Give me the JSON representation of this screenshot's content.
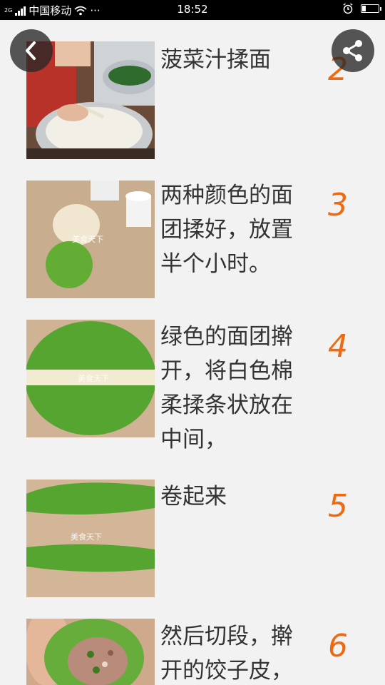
{
  "status_bar": {
    "carrier": "中国移动",
    "network_tag": "2G",
    "more": "···",
    "time": "18:52"
  },
  "nav": {
    "back_icon": "chevron-left-icon",
    "share_icon": "share-icon"
  },
  "steps": [
    {
      "number": "2",
      "text": "菠菜汁揉面"
    },
    {
      "number": "3",
      "text": "两种颜色的面团揉好，放置半个小时。"
    },
    {
      "number": "4",
      "text": "绿色的面团擀开，将白色棉柔揉条状放在中间，"
    },
    {
      "number": "5",
      "text": "卷起来"
    },
    {
      "number": "6",
      "text": "然后切段，擀开的饺子皮，"
    }
  ],
  "watermark": "美食天下",
  "colors": {
    "step_number": "#ee6a10",
    "status_bar_bg": "#000000",
    "page_bg": "#f2f2f2"
  }
}
